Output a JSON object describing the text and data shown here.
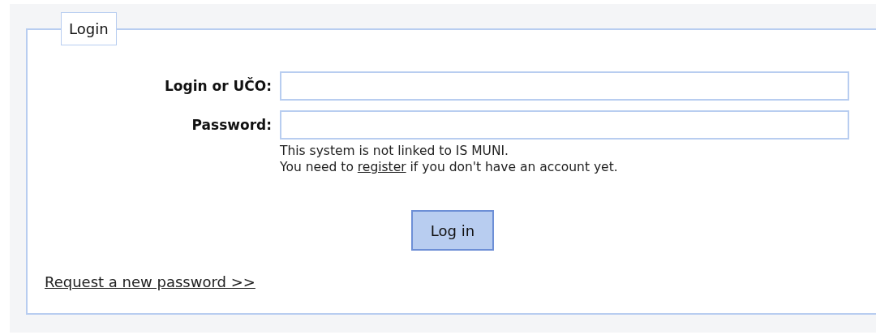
{
  "form": {
    "legend": "Login",
    "fields": [
      {
        "label": "Login or UČO:"
      },
      {
        "label": "Password:"
      }
    ],
    "notes": [
      "This system is not linked to IS MUNI."
    ],
    "account_note": {
      "before": "You need to",
      "link": "register",
      "after": "if you don't have an account yet."
    },
    "submit": "Log in",
    "reset_link": "Request a new password >>"
  }
}
